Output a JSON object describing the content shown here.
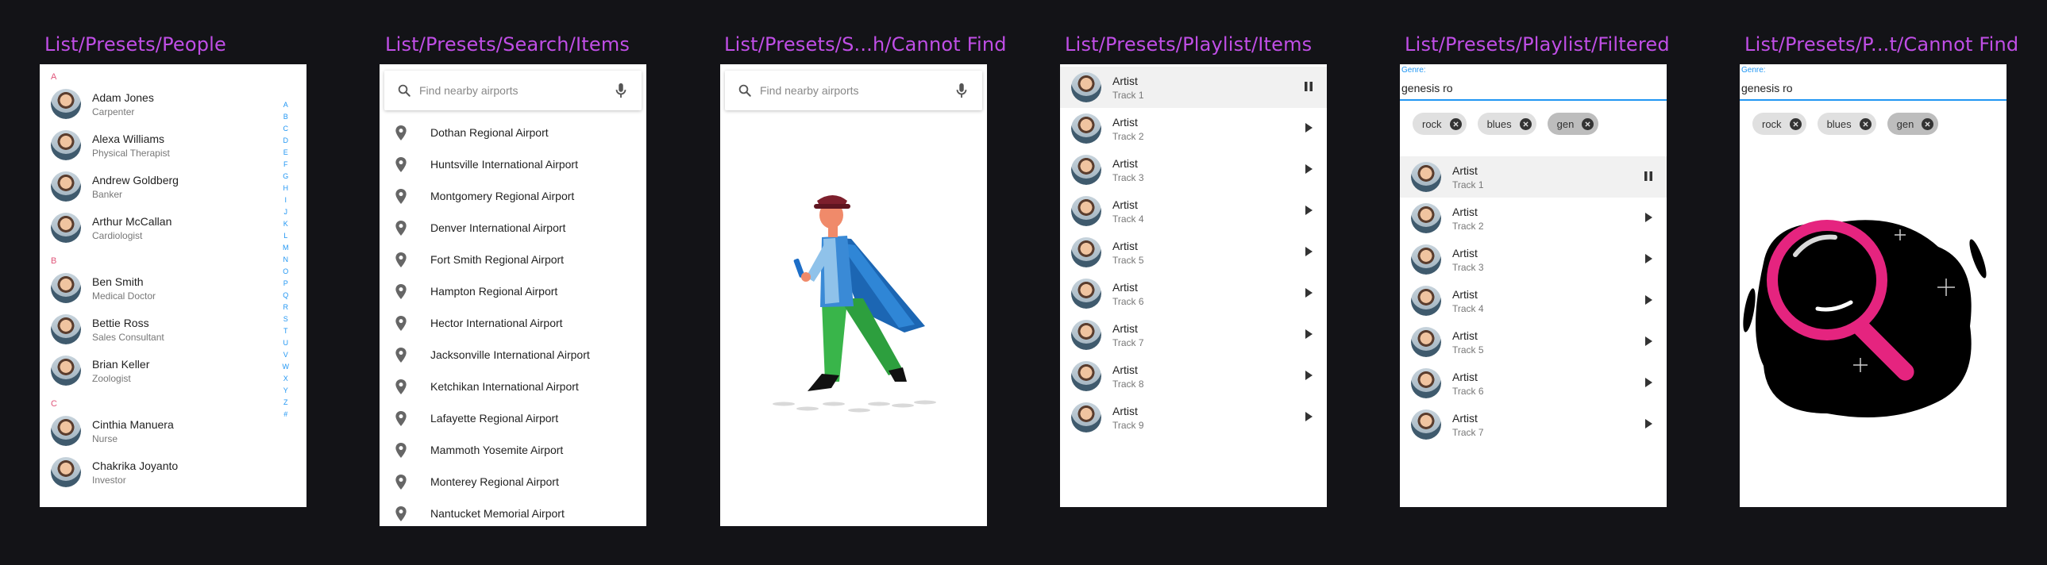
{
  "frames": {
    "people": "List/Presets/People",
    "search_items": "List/Presets/Search/Items",
    "search_cannot_find": "List/Presets/S...h/Cannot Find",
    "playlist_items": "List/Presets/Playlist/Items",
    "playlist_filtered": "List/Presets/Playlist/Filtered",
    "playlist_cannot_find": "List/Presets/P...t/Cannot Find"
  },
  "people": {
    "sections": [
      {
        "letter": "A",
        "items": [
          {
            "name": "Adam Jones",
            "role": "Carpenter"
          },
          {
            "name": "Alexa Williams",
            "role": "Physical Therapist"
          },
          {
            "name": "Andrew Goldberg",
            "role": "Banker"
          },
          {
            "name": "Arthur McCallan",
            "role": "Cardiologist"
          }
        ]
      },
      {
        "letter": "B",
        "items": [
          {
            "name": "Ben Smith",
            "role": "Medical Doctor"
          },
          {
            "name": "Bettie Ross",
            "role": "Sales Consultant"
          },
          {
            "name": "Brian Keller",
            "role": "Zoologist"
          }
        ]
      },
      {
        "letter": "C",
        "items": [
          {
            "name": "Cinthia Manuera",
            "role": "Nurse"
          },
          {
            "name": "Chakrika Joyanto",
            "role": "Investor"
          }
        ]
      }
    ],
    "alphabet": [
      "A",
      "B",
      "C",
      "D",
      "E",
      "F",
      "G",
      "H",
      "I",
      "J",
      "K",
      "L",
      "M",
      "N",
      "O",
      "P",
      "Q",
      "R",
      "S",
      "T",
      "U",
      "V",
      "W",
      "X",
      "Y",
      "Z",
      "#"
    ]
  },
  "search": {
    "placeholder": "Find nearby airports",
    "search_icon": "search-icon",
    "mic_icon": "microphone-icon",
    "results": [
      "Dothan Regional Airport",
      "Huntsville International Airport",
      "Montgomery Regional Airport",
      "Denver International Airport",
      "Fort Smith Regional Airport",
      "Hampton Regional Airport",
      "Hector International Airport",
      "Jacksonville International Airport",
      "Ketchikan International Airport",
      "Lafayette Regional Airport",
      "Mammoth Yosemite Airport",
      "Monterey Regional Airport",
      "Nantucket Memorial Airport"
    ]
  },
  "playlist": {
    "tracks": [
      {
        "artist": "Artist",
        "track": "Track 1",
        "state": "playing"
      },
      {
        "artist": "Artist",
        "track": "Track 2",
        "state": "paused"
      },
      {
        "artist": "Artist",
        "track": "Track 3",
        "state": "paused"
      },
      {
        "artist": "Artist",
        "track": "Track 4",
        "state": "paused"
      },
      {
        "artist": "Artist",
        "track": "Track 5",
        "state": "paused"
      },
      {
        "artist": "Artist",
        "track": "Track 6",
        "state": "paused"
      },
      {
        "artist": "Artist",
        "track": "Track 7",
        "state": "paused"
      },
      {
        "artist": "Artist",
        "track": "Track 8",
        "state": "paused"
      },
      {
        "artist": "Artist",
        "track": "Track 9",
        "state": "paused"
      }
    ]
  },
  "filter": {
    "label": "Genre:",
    "value_filtered": "genesis ro",
    "value_cannot_find": "genesis ro",
    "chips": [
      {
        "label": "rock",
        "selected": false
      },
      {
        "label": "blues",
        "selected": false
      },
      {
        "label": "gen",
        "selected": true
      }
    ],
    "tracks": [
      {
        "artist": "Artist",
        "track": "Track 1",
        "state": "playing"
      },
      {
        "artist": "Artist",
        "track": "Track 2",
        "state": "paused"
      },
      {
        "artist": "Artist",
        "track": "Track 3",
        "state": "paused"
      },
      {
        "artist": "Artist",
        "track": "Track 4",
        "state": "paused"
      },
      {
        "artist": "Artist",
        "track": "Track 5",
        "state": "paused"
      },
      {
        "artist": "Artist",
        "track": "Track 6",
        "state": "paused"
      },
      {
        "artist": "Artist",
        "track": "Track 7",
        "state": "paused"
      }
    ]
  },
  "colors": {
    "background": "#131317",
    "frame_title": "#c04ee6",
    "accent_blue": "#2196f3",
    "section_letter": "#e0557a",
    "magnifier_pink": "#e5247f"
  }
}
